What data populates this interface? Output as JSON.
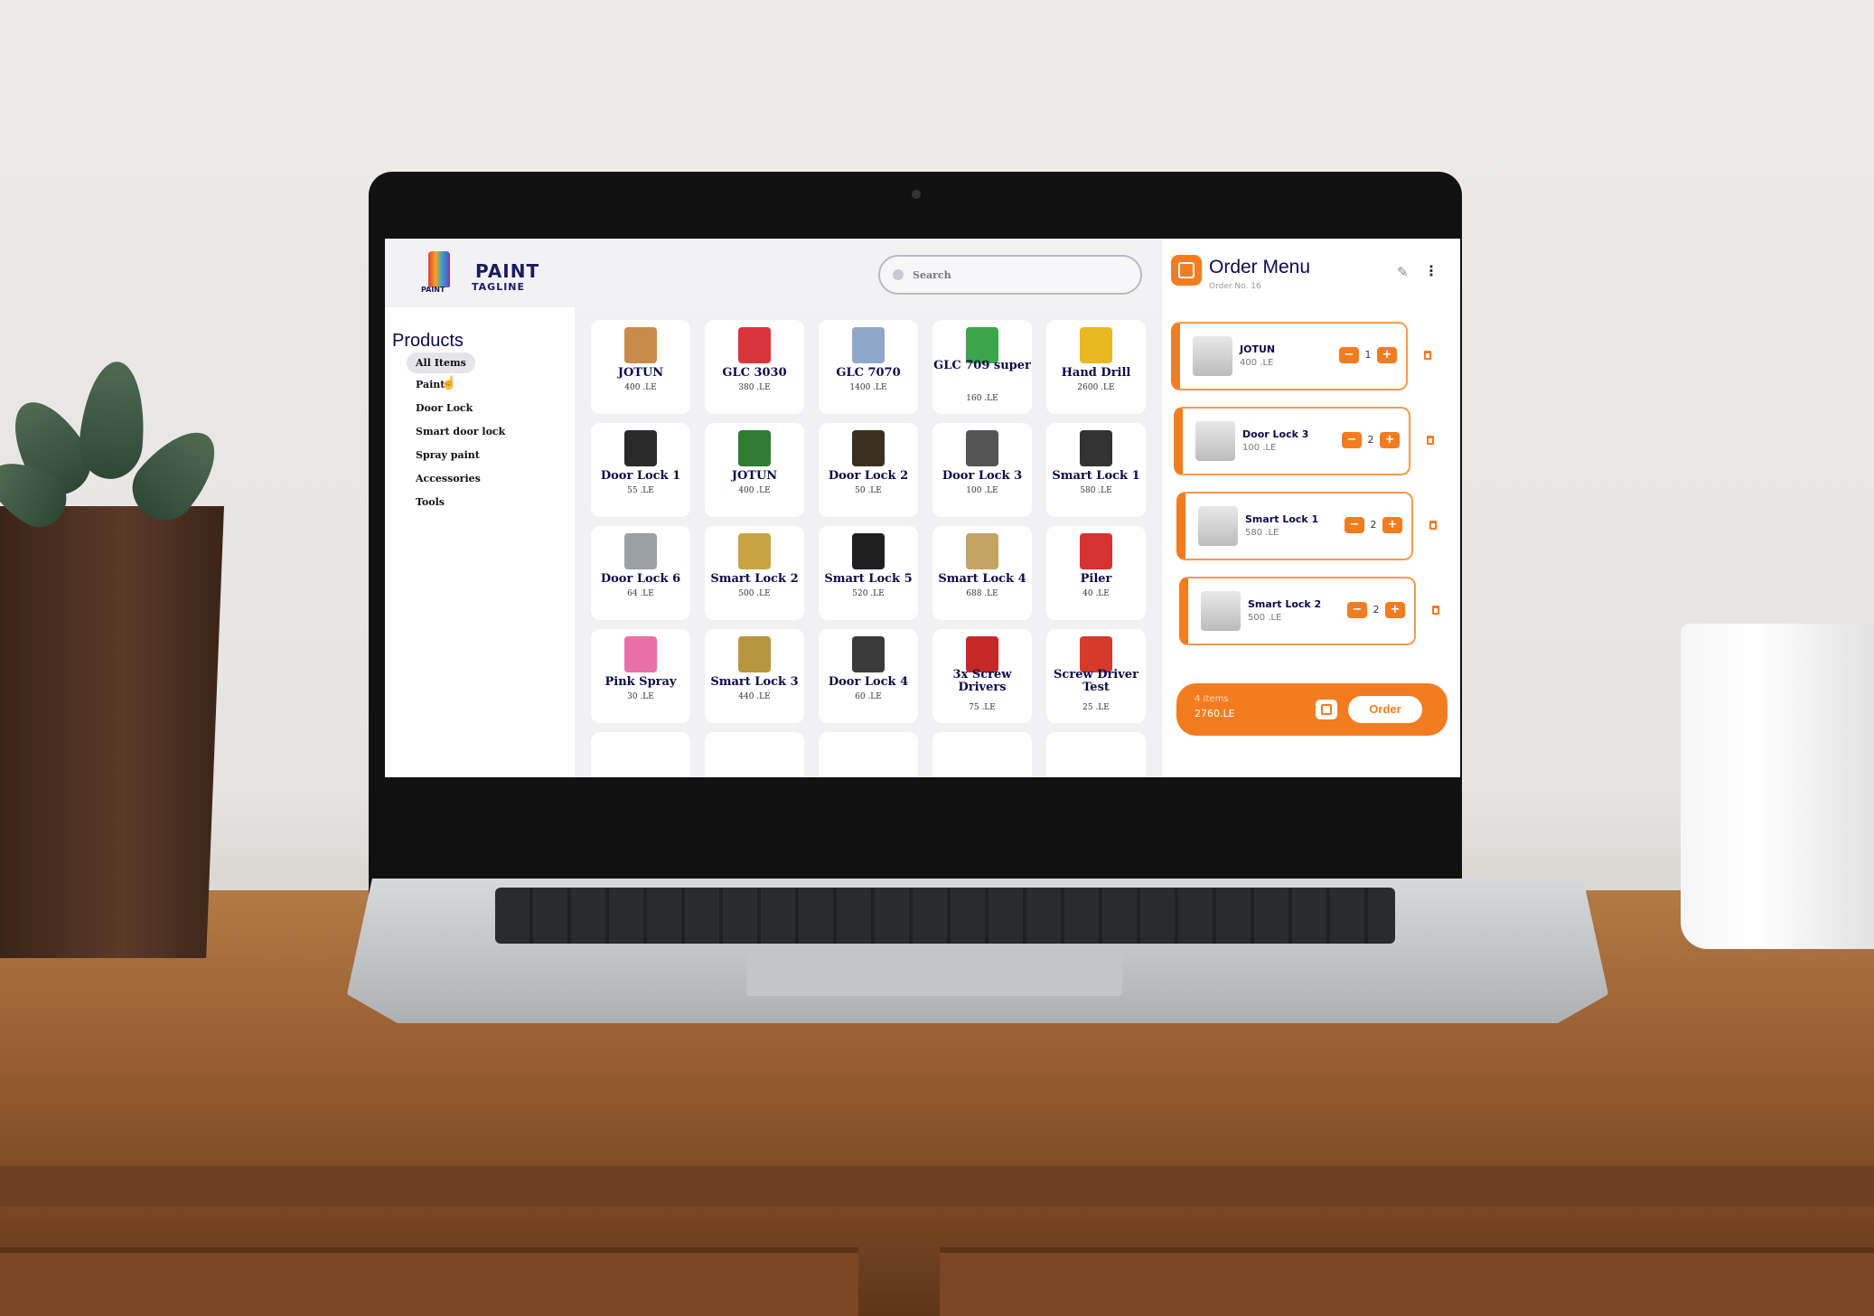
{
  "app": {
    "brand": "PAINT",
    "tagline": "TAGLINE",
    "logo_text": "PAINT"
  },
  "search": {
    "placeholder": "Search"
  },
  "sidebar": {
    "title": "Products",
    "items": [
      {
        "label": "All Items",
        "active": true
      },
      {
        "label": "Paint"
      },
      {
        "label": "Door Lock"
      },
      {
        "label": "Smart door lock"
      },
      {
        "label": "Spray paint"
      },
      {
        "label": "Accessories"
      },
      {
        "label": "Tools"
      }
    ]
  },
  "products": [
    {
      "name": "JOTUN",
      "price": "400 .LE",
      "thumb_color": "#c98b4a"
    },
    {
      "name": "GLC 3030",
      "price": "380 .LE",
      "thumb_color": "#d9353a"
    },
    {
      "name": "GLC 7070",
      "price": "1400 .LE",
      "thumb_color": "#8fa7c9"
    },
    {
      "name": "GLC 709 super",
      "price": "160 .LE",
      "thumb_color": "#3aa54a"
    },
    {
      "name": "Hand Drill",
      "price": "2600 .LE",
      "thumb_color": "#e8b820"
    },
    {
      "name": "Door Lock 1",
      "price": "55 .LE",
      "thumb_color": "#2a2a2a"
    },
    {
      "name": "JOTUN",
      "price": "400 .LE",
      "thumb_color": "#2f7d32"
    },
    {
      "name": "Door Lock 2",
      "price": "50 .LE",
      "thumb_color": "#3a2f20"
    },
    {
      "name": "Door Lock 3",
      "price": "100 .LE",
      "thumb_color": "#555555"
    },
    {
      "name": "Smart Lock 1",
      "price": "580 .LE",
      "thumb_color": "#333333"
    },
    {
      "name": "Door Lock 6",
      "price": "64 .LE",
      "thumb_color": "#9aa0a6"
    },
    {
      "name": "Smart Lock 2",
      "price": "500 .LE",
      "thumb_color": "#c9a445"
    },
    {
      "name": "Smart Lock 5",
      "price": "520 .LE",
      "thumb_color": "#1f1f1f"
    },
    {
      "name": "Smart Lock 4",
      "price": "688 .LE",
      "thumb_color": "#c2a463"
    },
    {
      "name": "Piler",
      "price": "40 .LE",
      "thumb_color": "#d73232"
    },
    {
      "name": "Pink Spray",
      "price": "30 .LE",
      "thumb_color": "#ea6fa8"
    },
    {
      "name": "Smart Lock 3",
      "price": "440 .LE",
      "thumb_color": "#b8963e"
    },
    {
      "name": "Door Lock 4",
      "price": "60 .LE",
      "thumb_color": "#3b3b3b"
    },
    {
      "name": "3x Screw Drivers",
      "price": "75 .LE",
      "thumb_color": "#c62828"
    },
    {
      "name": "Screw Driver Test",
      "price": "25 .LE",
      "thumb_color": "#d63a2a"
    }
  ],
  "order": {
    "title": "Order Menu",
    "number": "Order No. 16",
    "items": [
      {
        "name": "JOTUN",
        "price": "400 .LE",
        "qty": "1"
      },
      {
        "name": "Door Lock 3",
        "price": "100 .LE",
        "qty": "2"
      },
      {
        "name": "Smart Lock 1",
        "price": "580 .LE",
        "qty": "2"
      },
      {
        "name": "Smart Lock 2",
        "price": "500 .LE",
        "qty": "2"
      }
    ],
    "count": "4 Items",
    "total": "2760.LE",
    "order_label": "Order"
  },
  "colors": {
    "accent": "#f47c20",
    "navy": "#0b0b4a"
  }
}
